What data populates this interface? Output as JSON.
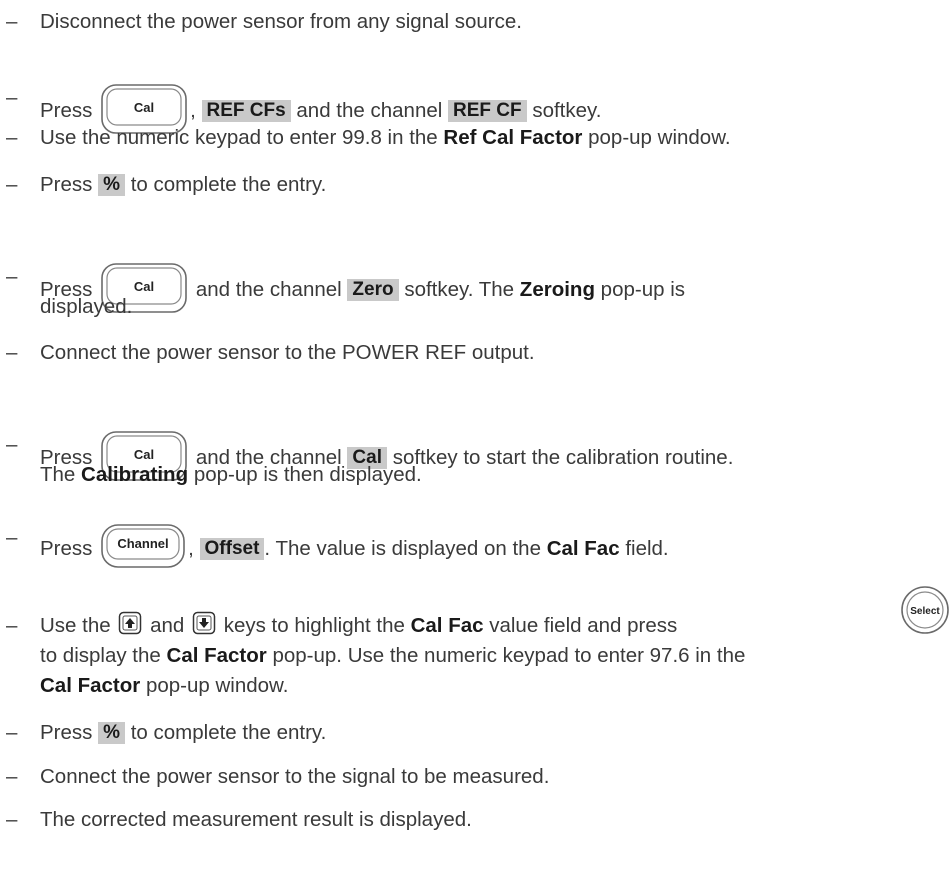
{
  "steps": {
    "s1": {
      "text": "Disconnect the power sensor from any signal source."
    },
    "s2": {
      "press": "Press",
      "key": "Cal",
      "comma": ",",
      "softkey1": "REF CFs",
      "mid": "and the channel",
      "softkey2": "REF CF",
      "end": "softkey."
    },
    "s3": {
      "pre": "Use the numeric keypad to enter 99.8 in the",
      "bold": "Ref Cal Factor",
      "post": "pop-up window."
    },
    "s4": {
      "press": "Press",
      "softkey": "%",
      "post": "to complete the entry."
    },
    "s5": {
      "press": "Press",
      "key": "Cal",
      "mid": "and the channel",
      "softkey": "Zero",
      "post1": "softkey. The",
      "bold": "Zeroing",
      "post2": "pop-up is",
      "line2": "displayed."
    },
    "s6": {
      "text": "Connect the power sensor to the POWER REF output."
    },
    "s7": {
      "press": "Press",
      "key": "Cal",
      "mid": "and the channel",
      "softkey": "Cal",
      "post": "softkey to start the calibration routine.",
      "line2_pre": "The",
      "line2_bold": "Calibrating",
      "line2_post": "pop-up is then displayed."
    },
    "s8": {
      "press": "Press",
      "key": "Channel",
      "comma": ",",
      "softkey": "Offset",
      "post1": ". The value is displayed on the",
      "bold": "Cal Fac",
      "post2": "field."
    },
    "s9": {
      "pre": "Use the",
      "and": "and",
      "mid": "keys to highlight the",
      "bold1": "Cal Fac",
      "mid2": "value field and press",
      "key": "Select",
      "line2_pre": "to display the",
      "line2_bold": "Cal Factor",
      "line2_post": "pop-up. Use the numeric keypad to enter 97.6 in the",
      "line3_bold": "Cal Factor",
      "line3_post": "pop-up window."
    },
    "s10": {
      "press": "Press",
      "softkey": "%",
      "post": "to complete the entry."
    },
    "s11": {
      "text": "Connect the power sensor to the signal to be measured."
    },
    "s12": {
      "text": "The corrected measurement result is displayed."
    }
  },
  "dash": "–"
}
